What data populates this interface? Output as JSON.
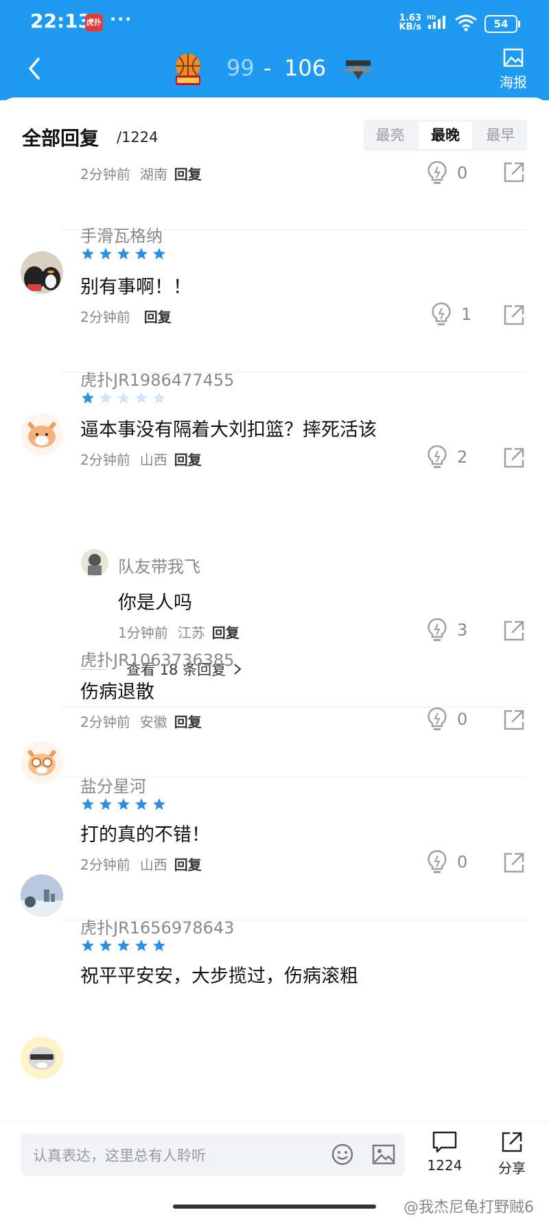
{
  "status_bar": {
    "time": "22:13",
    "app_badge": "虎扑",
    "more": "···",
    "net_speed": "1.63",
    "net_unit": "KB/s",
    "hd": "HD",
    "battery": "54"
  },
  "header": {
    "score_home": "99",
    "score_sep": "-",
    "score_away": "106",
    "poster_label": "海报"
  },
  "replies": {
    "title": "全部回复",
    "count": "/1224",
    "sort_tabs": [
      "最亮",
      "最晚",
      "最早"
    ],
    "active_sort": "最晚"
  },
  "comments": [
    {
      "user": "",
      "text": "",
      "time": "2分钟前",
      "location": "湖南",
      "reply_label": "回复",
      "lights": "0"
    },
    {
      "user": "手滑瓦格纳",
      "stars": 5,
      "text": "别有事啊！！",
      "time": "2分钟前",
      "location": "",
      "reply_label": "回复",
      "lights": "1"
    },
    {
      "user": "虎扑JR1986477455",
      "stars": 1,
      "text": "逼本事没有隔着大刘扣篮？摔死活该",
      "time": "2分钟前",
      "location": "山西",
      "reply_label": "回复",
      "lights": "2",
      "sub_reply": {
        "user": "队友带我飞",
        "text": "你是人吗",
        "time": "1分钟前",
        "location": "江苏",
        "reply_label": "回复",
        "lights": "3"
      },
      "more_replies": "查看 18 条回复"
    },
    {
      "user": "虎扑JR1063736385",
      "text": "伤病退散",
      "time": "2分钟前",
      "location": "安徽",
      "reply_label": "回复",
      "lights": "0"
    },
    {
      "user": "盐分星河",
      "stars": 5,
      "text": "打的真的不错！",
      "time": "2分钟前",
      "location": "山西",
      "reply_label": "回复",
      "lights": "0"
    },
    {
      "user": "虎扑JR1656978643",
      "stars": 5,
      "text": "祝平平安安，大步揽过，伤病滚粗"
    }
  ],
  "bottom_bar": {
    "input_placeholder": "认真表达，这里总有人聆听",
    "comment_count": "1224",
    "share_label": "分享",
    "watermark": "@我杰尼龟打野贼6"
  },
  "colors": {
    "brand_blue": "#1e9bf0",
    "star_blue": "#2b8fe3",
    "star_empty": "#cfe6fa"
  }
}
